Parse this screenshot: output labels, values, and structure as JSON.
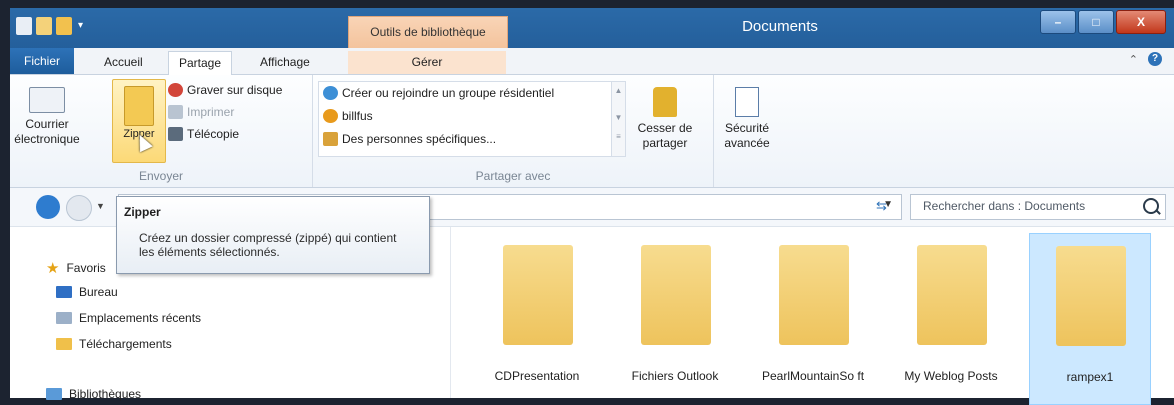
{
  "window": {
    "title": "Documents",
    "context_tab_group": "Outils de bibliothèque",
    "controls": [
      "–",
      "□",
      "X"
    ]
  },
  "tabs": {
    "file": "Fichier",
    "home": "Accueil",
    "share": "Partage",
    "view": "Affichage",
    "manage": "Gérer"
  },
  "ribbon": {
    "send": {
      "label": "Envoyer",
      "email": [
        "Courrier",
        "électronique"
      ],
      "zip": "Zipper",
      "burn": "Graver sur disque",
      "print": "Imprimer",
      "fax": "Télécopie"
    },
    "share_with": {
      "label": "Partager avec",
      "items": [
        "Créer ou rejoindre un groupe résidentiel",
        "billfus",
        "Des personnes spécifiques..."
      ],
      "stop": [
        "Cesser de",
        "partager"
      ],
      "security": [
        "Sécurité",
        "avancée"
      ]
    }
  },
  "address": {
    "search_placeholder": "Rechercher dans : Documents"
  },
  "tooltip": {
    "title": "Zipper",
    "description": "Créez un dossier compressé (zippé) qui contient les éléments sélectionnés."
  },
  "nav": {
    "favorites": "Favoris",
    "items": [
      "Bureau",
      "Emplacements récents",
      "Téléchargements"
    ],
    "libraries": "Bibliothèques"
  },
  "files": [
    {
      "name": "CDPresentation",
      "selected": false
    },
    {
      "name": "Fichiers Outlook",
      "selected": false
    },
    {
      "name": "PearlMountainSo ft",
      "selected": false
    },
    {
      "name": "My Weblog Posts",
      "selected": false
    },
    {
      "name": "rampex1",
      "selected": true
    }
  ],
  "colors": {
    "titlebar": "#2b6aa8",
    "context_tab": "#f3c39c",
    "selection": "#cce8ff"
  }
}
